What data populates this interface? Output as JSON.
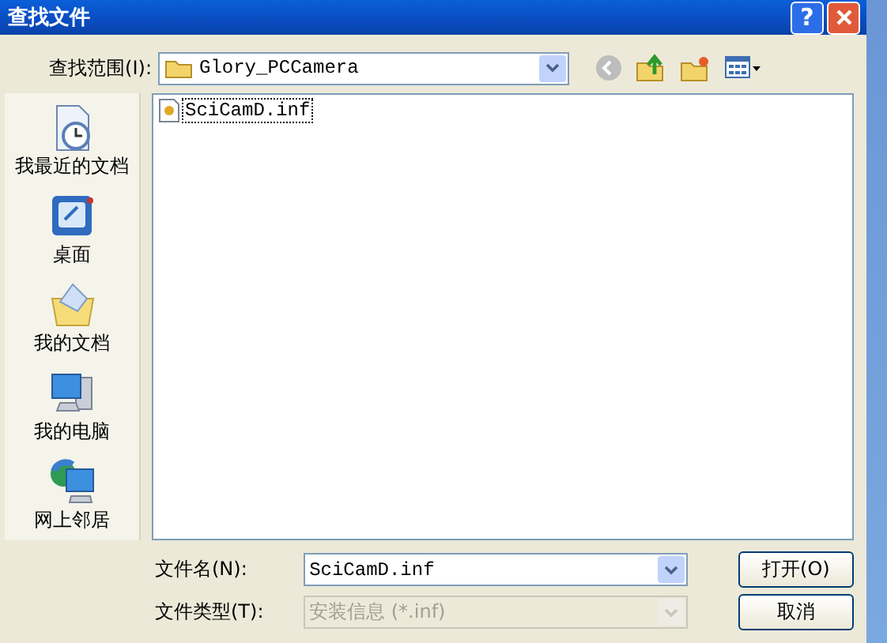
{
  "window": {
    "title": "查找文件",
    "help_button": "?"
  },
  "look_in": {
    "label": "查找范围(I):",
    "value": "Glory_PCCamera"
  },
  "places": [
    {
      "label": "我最近的文档"
    },
    {
      "label": "桌面"
    },
    {
      "label": "我的文档"
    },
    {
      "label": "我的电脑"
    },
    {
      "label": "网上邻居"
    }
  ],
  "files": [
    {
      "name": "SciCamD.inf",
      "selected": true
    }
  ],
  "file_name": {
    "label": "文件名(N):",
    "value": "SciCamD.inf",
    "disabled": false
  },
  "file_type": {
    "label": "文件类型(T):",
    "value": "安装信息 (*.inf)",
    "disabled": true
  },
  "buttons": [
    "打开(O)",
    "取消"
  ]
}
